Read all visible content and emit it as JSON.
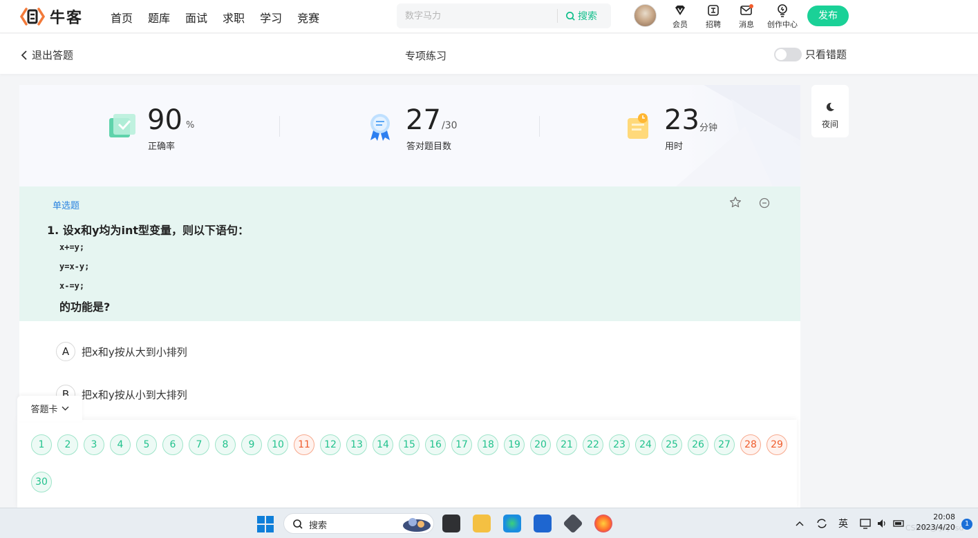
{
  "nav": {
    "logo_text": "牛客",
    "links": [
      "首页",
      "题库",
      "面试",
      "求职",
      "学习",
      "竞赛"
    ],
    "search_placeholder": "数字马力",
    "search_button": "搜索",
    "icons": [
      {
        "label": "会员",
        "icon": "vip-icon"
      },
      {
        "label": "招聘",
        "icon": "recruit-icon"
      },
      {
        "label": "消息",
        "icon": "message-icon"
      },
      {
        "label": "创作中心",
        "icon": "lightbulb-icon"
      }
    ],
    "publish": "发布"
  },
  "subheader": {
    "exit": "退出答题",
    "title": "专项练习",
    "wrong_only": "只看错题"
  },
  "stats": {
    "accuracy": {
      "value": "90",
      "unit": "%",
      "label": "正确率"
    },
    "correct": {
      "value": "27",
      "unit": "/30",
      "label": "答对题目数"
    },
    "time": {
      "value": "23",
      "unit": "分钟",
      "label": "用时"
    }
  },
  "question": {
    "type": "单选题",
    "title": "1. 设x和y均为int型变量，则以下语句：",
    "code": [
      "x+=y;",
      "y=x-y;",
      "x-=y;"
    ],
    "tail": "的功能是?",
    "options": [
      {
        "letter": "A",
        "text": "把x和y按从大到小排列"
      },
      {
        "letter": "B",
        "text": "把x和y按从小到大排列"
      }
    ]
  },
  "night_mode": "夜间",
  "answer_card": {
    "label": "答题卡",
    "numbers": [
      "1",
      "2",
      "3",
      "4",
      "5",
      "6",
      "7",
      "8",
      "9",
      "10",
      "11",
      "12",
      "13",
      "14",
      "15",
      "16",
      "17",
      "18",
      "19",
      "20",
      "21",
      "22",
      "23",
      "24",
      "25",
      "26",
      "27",
      "28",
      "29",
      "30"
    ],
    "wrong": [
      "11",
      "28",
      "29"
    ]
  },
  "taskbar": {
    "search": "搜索",
    "ime": "英",
    "time": "20:08",
    "date": "2023/4/20",
    "notifications": "1",
    "watermark": "CSDN @小小fsd"
  },
  "colors": {
    "brand_green": "#1ad197",
    "correct": "#22c28d",
    "wrong": "#ef5d2d",
    "question_bg": "#e6f5f1",
    "link_blue": "#2b83e0"
  }
}
